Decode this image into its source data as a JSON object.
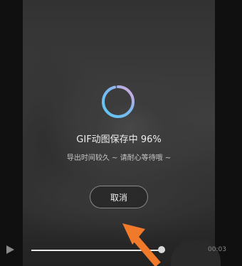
{
  "dialog": {
    "title": "GIF动图保存中",
    "progress_text": "96%",
    "progress": 0.96,
    "subtitle": "导出时间较久 ~ 请耐心等待哦 ~",
    "cancel_label": "取消"
  },
  "player": {
    "play_icon": "play-icon",
    "seek_progress": 0.95,
    "time_label": "00:03"
  },
  "colors": {
    "spinner_start": "#5ec8f5",
    "spinner_end": "#e9a6d8",
    "arrow": "#f07a2a"
  }
}
